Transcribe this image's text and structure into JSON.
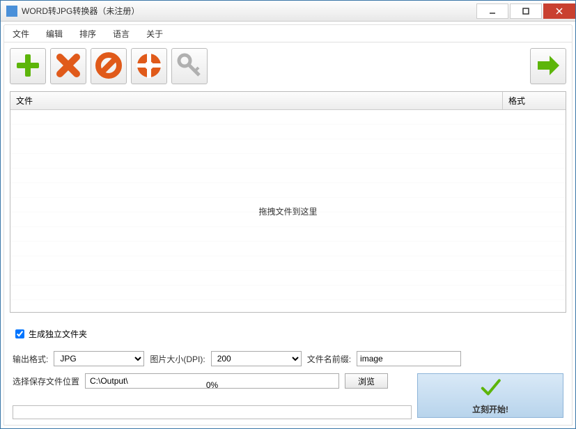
{
  "window": {
    "title": "WORD转JPG转换器（未注册）"
  },
  "menu": {
    "items": [
      "文件",
      "编辑",
      "排序",
      "语言",
      "关于"
    ]
  },
  "toolbar": {
    "icons": [
      "add-icon",
      "delete-icon",
      "clear-icon",
      "help-icon",
      "register-icon",
      "next-icon"
    ]
  },
  "filelist": {
    "col_file": "文件",
    "col_format": "格式",
    "drop_hint": "拖拽文件到这里"
  },
  "options": {
    "independent_folder_label": "生成独立文件夹",
    "independent_folder_checked": true,
    "output_format_label": "输出格式:",
    "output_format_value": "JPG",
    "dpi_label": "图片大小(DPI):",
    "dpi_value": "200",
    "prefix_label": "文件名前缀:",
    "prefix_value": "image",
    "output_path_label": "选择保存文件位置",
    "output_path_value": "C:\\Output\\",
    "browse_label": "浏览"
  },
  "progress": {
    "text": "0%"
  },
  "start": {
    "label": "立刻开始!"
  }
}
